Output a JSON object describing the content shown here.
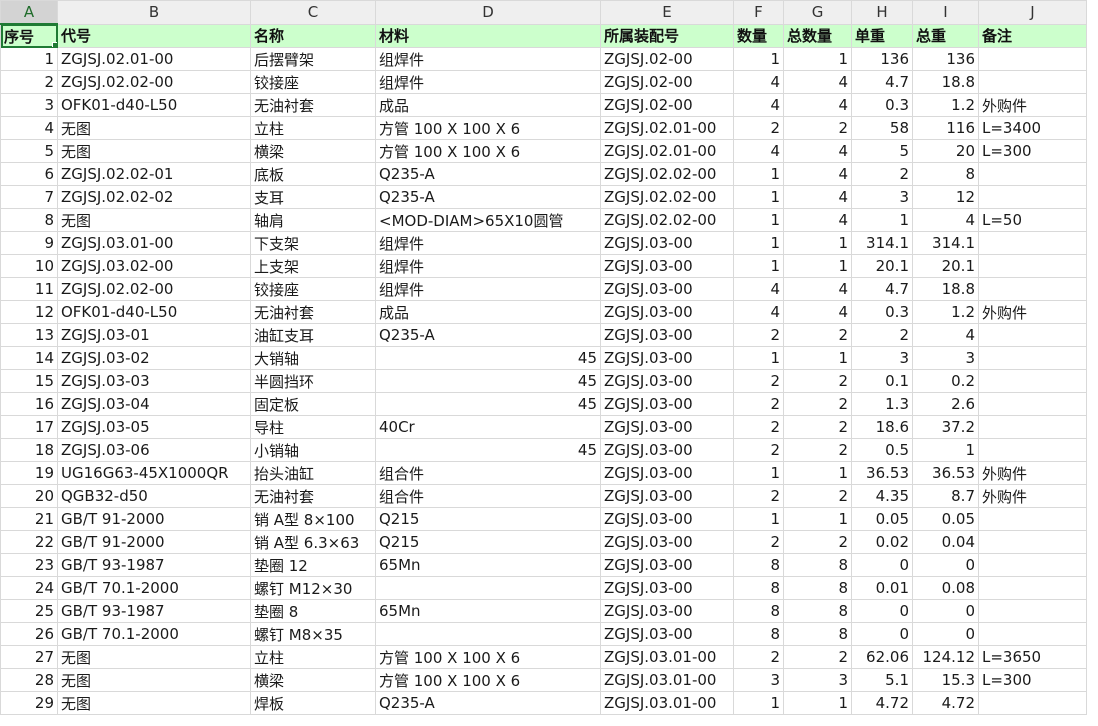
{
  "columns": [
    "A",
    "B",
    "C",
    "D",
    "E",
    "F",
    "G",
    "H",
    "I",
    "J"
  ],
  "header": [
    "序号",
    "代号",
    "名称",
    "材料",
    "所属装配号",
    "数量",
    "总数量",
    "单重",
    "总重",
    "备注"
  ],
  "rows": [
    [
      "1",
      "ZGJSJ.02.01-00",
      "后摆臂架",
      "组焊件",
      "ZGJSJ.02-00",
      "1",
      "1",
      "136",
      "136",
      ""
    ],
    [
      "2",
      "ZGJSJ.02.02-00",
      "铰接座",
      "组焊件",
      "ZGJSJ.02-00",
      "4",
      "4",
      "4.7",
      "18.8",
      ""
    ],
    [
      "3",
      "OFK01-d40-L50",
      "无油衬套",
      "成品",
      "ZGJSJ.02-00",
      "4",
      "4",
      "0.3",
      "1.2",
      "外购件"
    ],
    [
      "4",
      "无图",
      "立柱",
      "方管 100 X 100 X 6",
      "ZGJSJ.02.01-00",
      "2",
      "2",
      "58",
      "116",
      "L=3400"
    ],
    [
      "5",
      "无图",
      "横梁",
      "方管 100 X 100 X 6",
      "ZGJSJ.02.01-00",
      "4",
      "4",
      "5",
      "20",
      "L=300"
    ],
    [
      "6",
      "ZGJSJ.02.02-01",
      "底板",
      "Q235-A",
      "ZGJSJ.02.02-00",
      "1",
      "4",
      "2",
      "8",
      ""
    ],
    [
      "7",
      "ZGJSJ.02.02-02",
      "支耳",
      "Q235-A",
      "ZGJSJ.02.02-00",
      "1",
      "4",
      "3",
      "12",
      ""
    ],
    [
      "8",
      "无图",
      "轴肩",
      "<MOD-DIAM>65X10圆管",
      "ZGJSJ.02.02-00",
      "1",
      "4",
      "1",
      "4",
      "L=50"
    ],
    [
      "9",
      "ZGJSJ.03.01-00",
      "下支架",
      "组焊件",
      "ZGJSJ.03-00",
      "1",
      "1",
      "314.1",
      "314.1",
      ""
    ],
    [
      "10",
      "ZGJSJ.03.02-00",
      "上支架",
      "组焊件",
      "ZGJSJ.03-00",
      "1",
      "1",
      "20.1",
      "20.1",
      ""
    ],
    [
      "11",
      "ZGJSJ.02.02-00",
      "铰接座",
      "组焊件",
      "ZGJSJ.03-00",
      "4",
      "4",
      "4.7",
      "18.8",
      ""
    ],
    [
      "12",
      "OFK01-d40-L50",
      "无油衬套",
      "成品",
      "ZGJSJ.03-00",
      "4",
      "4",
      "0.3",
      "1.2",
      "外购件"
    ],
    [
      "13",
      "ZGJSJ.03-01",
      "油缸支耳",
      "Q235-A",
      "ZGJSJ.03-00",
      "2",
      "2",
      "2",
      "4",
      ""
    ],
    [
      "14",
      "ZGJSJ.03-02",
      "大销轴",
      "45",
      "ZGJSJ.03-00",
      "1",
      "1",
      "3",
      "3",
      ""
    ],
    [
      "15",
      "ZGJSJ.03-03",
      "半圆挡环",
      "45",
      "ZGJSJ.03-00",
      "2",
      "2",
      "0.1",
      "0.2",
      ""
    ],
    [
      "16",
      "ZGJSJ.03-04",
      "固定板",
      "45",
      "ZGJSJ.03-00",
      "2",
      "2",
      "1.3",
      "2.6",
      ""
    ],
    [
      "17",
      "ZGJSJ.03-05",
      "导柱",
      "40Cr",
      "ZGJSJ.03-00",
      "2",
      "2",
      "18.6",
      "37.2",
      ""
    ],
    [
      "18",
      "ZGJSJ.03-06",
      "小销轴",
      "45",
      "ZGJSJ.03-00",
      "2",
      "2",
      "0.5",
      "1",
      ""
    ],
    [
      "19",
      "UG16G63-45X1000QR",
      "抬头油缸",
      "组合件",
      "ZGJSJ.03-00",
      "1",
      "1",
      "36.53",
      "36.53",
      "外购件"
    ],
    [
      "20",
      "QGB32-d50",
      "无油衬套",
      "组合件",
      "ZGJSJ.03-00",
      "2",
      "2",
      "4.35",
      "8.7",
      "外购件"
    ],
    [
      "21",
      "GB/T 91-2000",
      "销 A型 8×100",
      "Q215",
      "ZGJSJ.03-00",
      "1",
      "1",
      "0.05",
      "0.05",
      ""
    ],
    [
      "22",
      "GB/T 91-2000",
      "销 A型 6.3×63",
      "Q215",
      "ZGJSJ.03-00",
      "2",
      "2",
      "0.02",
      "0.04",
      ""
    ],
    [
      "23",
      "GB/T 93-1987",
      "垫圈 12",
      "65Mn",
      "ZGJSJ.03-00",
      "8",
      "8",
      "0",
      "0",
      ""
    ],
    [
      "24",
      "GB/T 70.1-2000",
      "螺钉 M12×30",
      "",
      "ZGJSJ.03-00",
      "8",
      "8",
      "0.01",
      "0.08",
      ""
    ],
    [
      "25",
      "GB/T 93-1987",
      "垫圈 8",
      "65Mn",
      "ZGJSJ.03-00",
      "8",
      "8",
      "0",
      "0",
      ""
    ],
    [
      "26",
      "GB/T 70.1-2000",
      "螺钉 M8×35",
      "",
      "ZGJSJ.03-00",
      "8",
      "8",
      "0",
      "0",
      ""
    ],
    [
      "27",
      "无图",
      "立柱",
      "方管 100 X 100 X 6",
      "ZGJSJ.03.01-00",
      "2",
      "2",
      "62.06",
      "124.12",
      "L=3650"
    ],
    [
      "28",
      "无图",
      "横梁",
      "方管 100 X 100 X 6",
      "ZGJSJ.03.01-00",
      "3",
      "3",
      "5.1",
      "15.3",
      "L=300"
    ],
    [
      "29",
      "无图",
      "焊板",
      "Q235-A",
      "ZGJSJ.03.01-00",
      "1",
      "1",
      "4.72",
      "4.72",
      ""
    ]
  ],
  "selected_cell": "A2",
  "colors": {
    "header_fill": "#ccffcc",
    "selection": "#1f7a34",
    "grid": "#d9d9d9"
  }
}
